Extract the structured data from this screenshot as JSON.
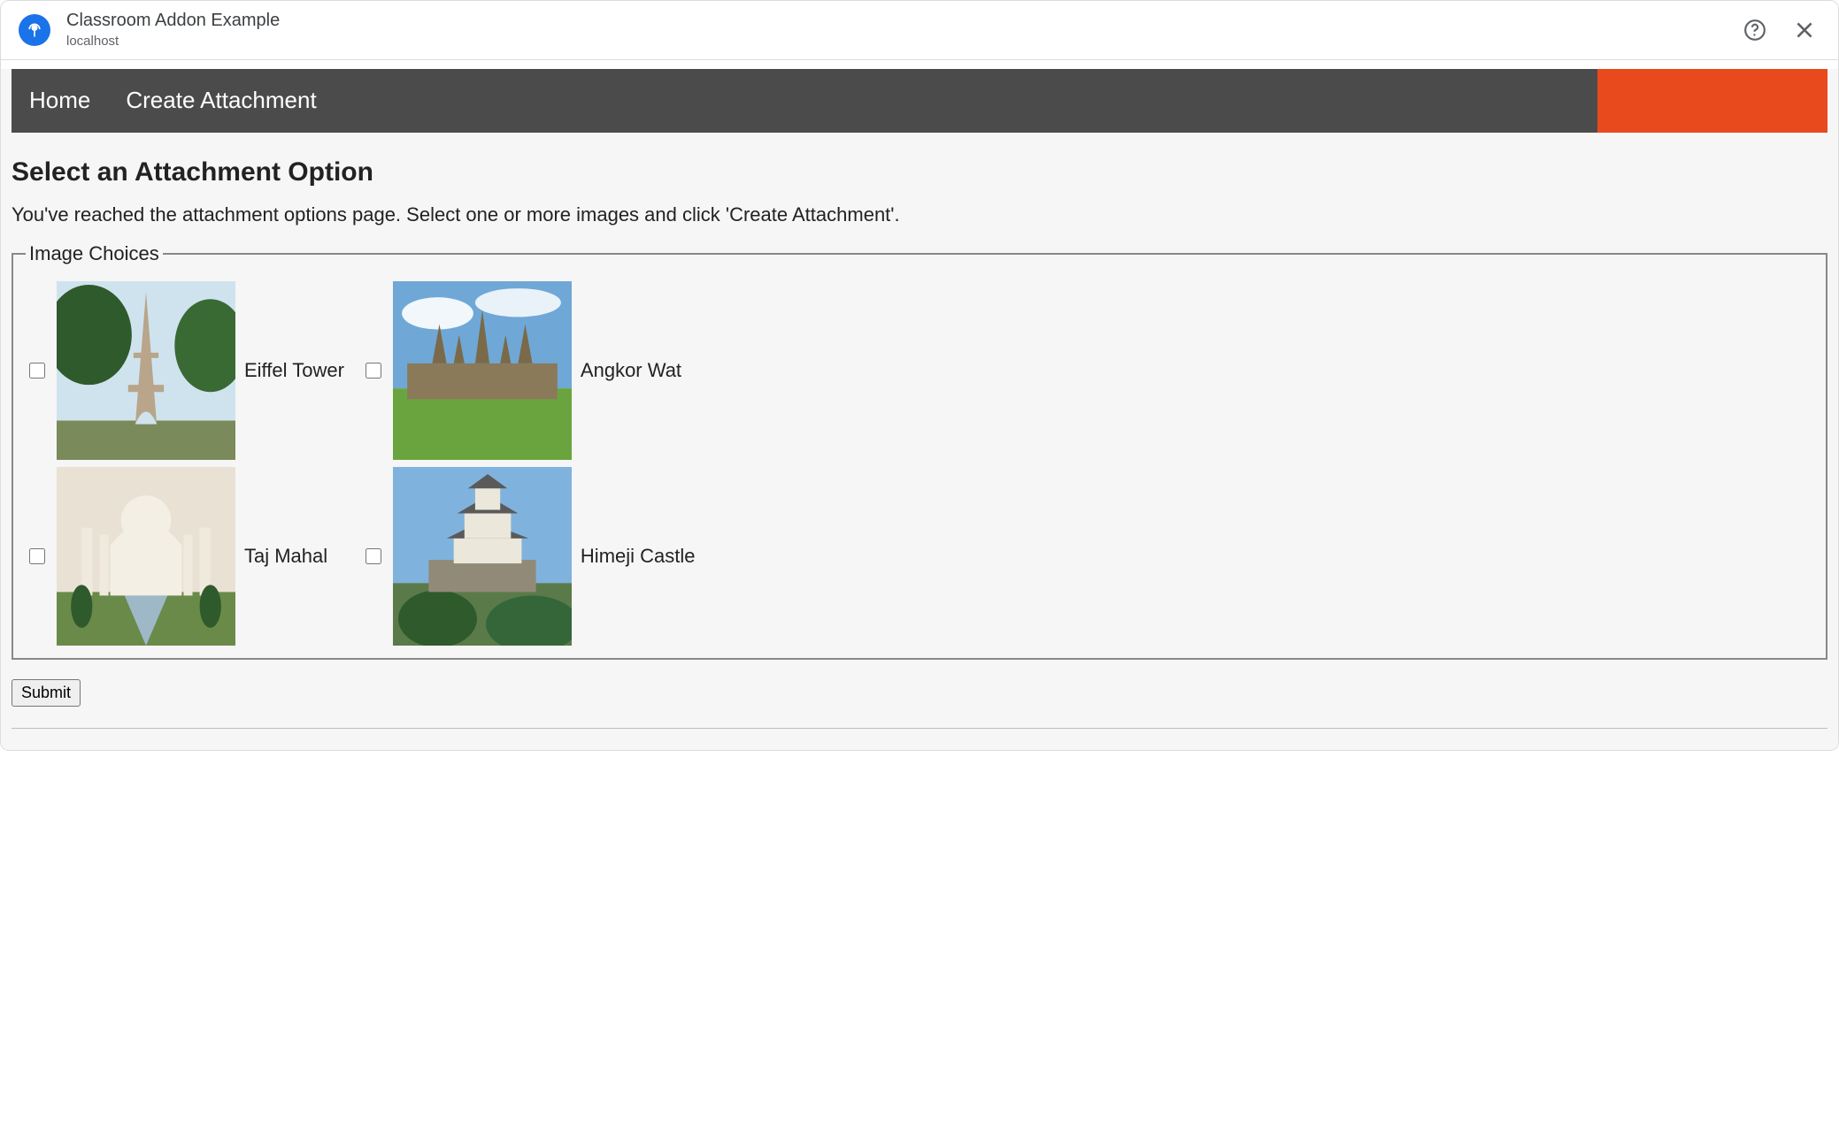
{
  "header": {
    "title": "Classroom Addon Example",
    "subtitle": "localhost"
  },
  "nav": {
    "home": "Home",
    "create": "Create Attachment"
  },
  "page": {
    "heading": "Select an Attachment Option",
    "lead": "You've reached the attachment options page. Select one or more images and click 'Create Attachment'.",
    "fieldset_legend": "Image Choices",
    "submit_label": "Submit"
  },
  "choices": [
    {
      "label": "Eiffel Tower"
    },
    {
      "label": "Angkor Wat"
    },
    {
      "label": "Taj Mahal"
    },
    {
      "label": "Himeji Castle"
    }
  ]
}
